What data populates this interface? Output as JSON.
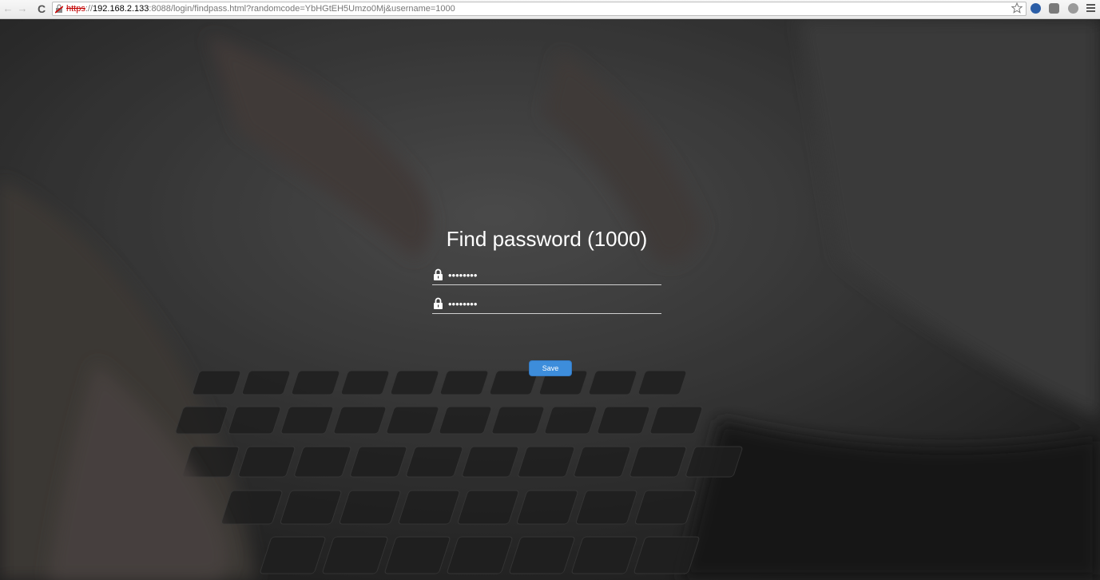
{
  "browser": {
    "url_scheme": "https",
    "url_separator": "://",
    "url_host": "192.168.2.133",
    "url_rest": ":8088/login/findpass.html?randomcode=YbHGtEH5Umzo0Mj&username=1000",
    "icons": {
      "back": "back-arrow-icon",
      "forward": "forward-arrow-icon",
      "reload": "reload-icon",
      "security": "broken-lock-icon",
      "bookmark": "star-icon",
      "menu": "hamburger-menu-icon"
    }
  },
  "page": {
    "title": "Find password (1000)",
    "password_field": {
      "value": "********",
      "icon": "lock-icon"
    },
    "confirm_password_field": {
      "value": "********",
      "icon": "lock-icon"
    },
    "save_label": "Save",
    "colors": {
      "button": "#3d8ddb",
      "title_text": "#ffffff"
    }
  }
}
